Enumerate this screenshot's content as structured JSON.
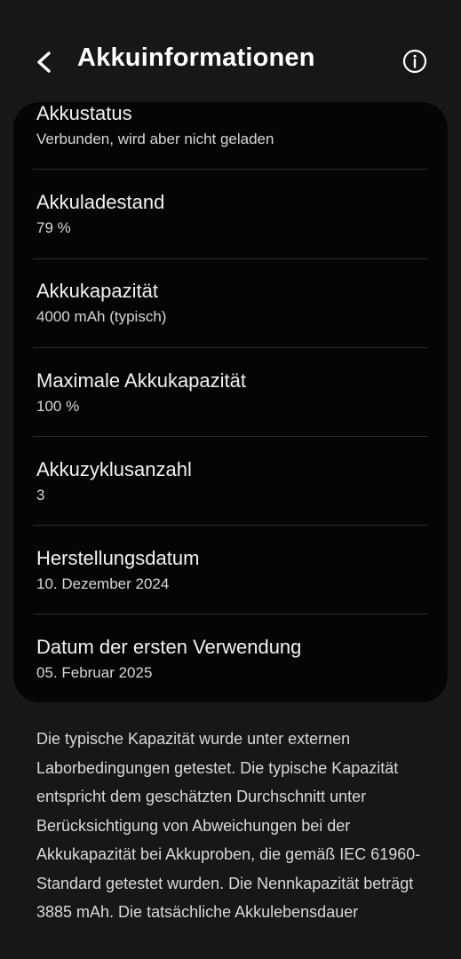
{
  "header": {
    "title": "Akkuinformationen",
    "back_icon": "chevron-left-icon",
    "info_icon": "info-circle-icon"
  },
  "rows": [
    {
      "label": "Akkustatus",
      "value": "Verbunden, wird aber nicht geladen"
    },
    {
      "label": "Akkuladestand",
      "value": "79 %"
    },
    {
      "label": "Akkukapazität",
      "value": "4000 mAh (typisch)"
    },
    {
      "label": "Maximale Akkukapazität",
      "value": "100 %"
    },
    {
      "label": "Akkuzyklusanzahl",
      "value": "3"
    },
    {
      "label": "Herstellungsdatum",
      "value": "10. Dezember 2024"
    },
    {
      "label": "Datum der ersten Verwendung",
      "value": "05. Februar 2025"
    }
  ],
  "note": "Die typische Kapazität wurde unter externen Laborbedingungen getestet. Die typische Kapazität entspricht dem geschätzten Durchschnitt unter Berücksichtigung von Abweichungen bei der Akkukapazität bei Akkuproben, die gemäß IEC 61960-Standard getestet wurden. Die Nennkapazität beträgt 3885 mAh. Die tatsächliche Akkulebensdauer",
  "colors": {
    "background": "#171717",
    "card": "#050505",
    "text": "#f5f5f5"
  }
}
